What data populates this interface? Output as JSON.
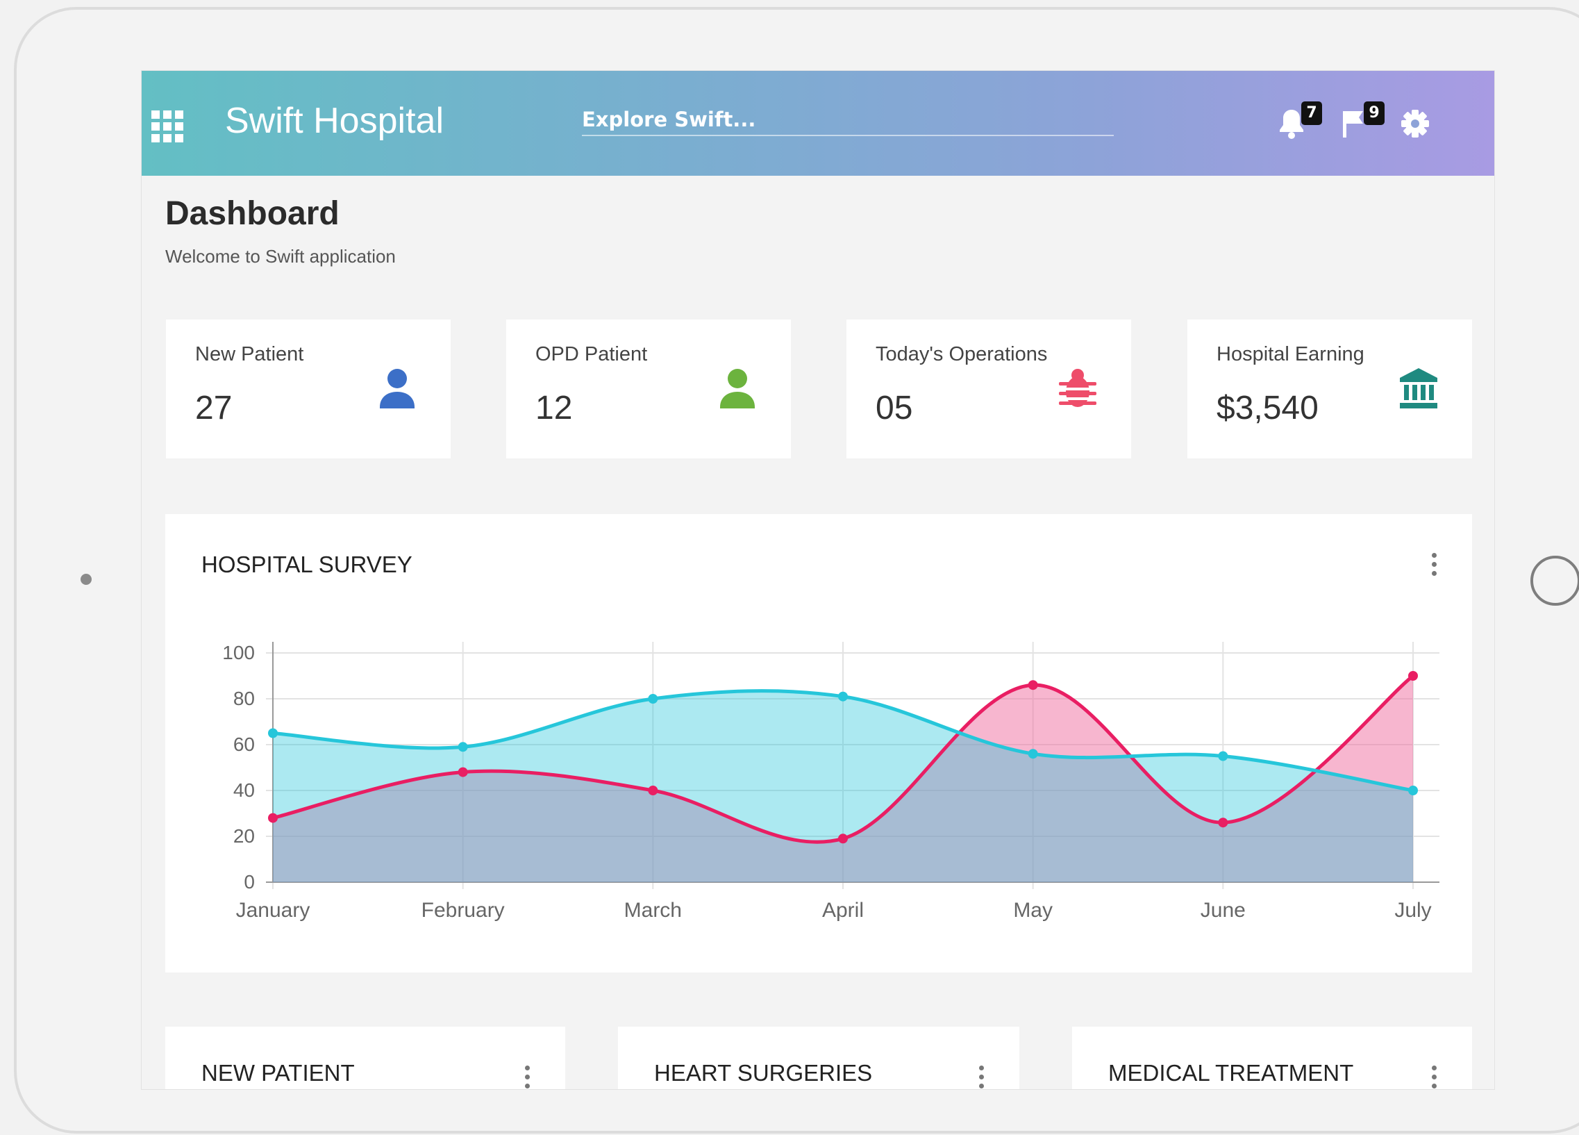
{
  "header": {
    "app_title": "Swift Hospital",
    "search_placeholder": "Explore Swift...",
    "notifications_count": "7",
    "flags_count": "9",
    "gradient_colors": [
      "#63bfc4",
      "#a89be3"
    ]
  },
  "page": {
    "title": "Dashboard",
    "subtitle": "Welcome to Swift application"
  },
  "stats": [
    {
      "label": "New Patient",
      "value": "27",
      "icon": "user-icon",
      "color": "#3c6fc7"
    },
    {
      "label": "OPD Patient",
      "value": "12",
      "icon": "user-icon",
      "color": "#6cb33e"
    },
    {
      "label": "Today's Operations",
      "value": "05",
      "icon": "bug-icon",
      "color": "#ee4d6a"
    },
    {
      "label": "Hospital Earning",
      "value": "$3,540",
      "icon": "bank-icon",
      "color": "#1f8a80"
    }
  ],
  "survey": {
    "title": "HOSPITAL SURVEY"
  },
  "chart_data": {
    "type": "area",
    "title": "HOSPITAL SURVEY",
    "categories": [
      "January",
      "February",
      "March",
      "April",
      "May",
      "June",
      "July"
    ],
    "series": [
      {
        "values": [
          28,
          48,
          40,
          19,
          86,
          26,
          90
        ],
        "color": "#e91e63"
      },
      {
        "values": [
          65,
          59,
          80,
          81,
          56,
          55,
          40
        ],
        "color": "#26c6da"
      }
    ],
    "yticks": [
      "0",
      "20",
      "40",
      "60",
      "80",
      "100"
    ],
    "ylim": [
      0,
      100
    ],
    "grid": true,
    "legend": "none"
  },
  "bottom_cards": [
    {
      "title": "NEW PATIENT"
    },
    {
      "title": "HEART SURGERIES"
    },
    {
      "title": "MEDICAL TREATMENT"
    }
  ]
}
